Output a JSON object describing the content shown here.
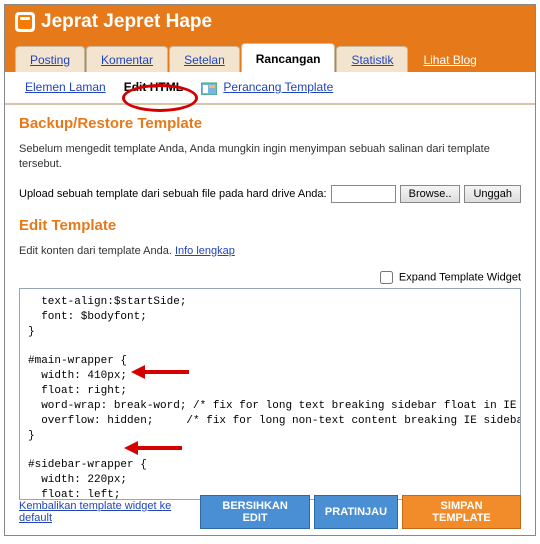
{
  "header": {
    "title": "Jeprat Jepret Hape"
  },
  "tabs": [
    "Posting",
    "Komentar",
    "Setelan",
    "Rancangan",
    "Statistik",
    "Lihat Blog"
  ],
  "active_tab": 3,
  "subtabs": {
    "items": [
      "Elemen Laman",
      "Edit HTML",
      "Perancang Template"
    ],
    "active": 1
  },
  "backup": {
    "heading": "Backup/Restore Template",
    "desc": "Sebelum mengedit template Anda, Anda mungkin ingin menyimpan sebuah salinan dari template tersebut.",
    "upload_label": "Upload sebuah template dari sebuah file pada hard drive Anda:",
    "browse": "Browse..",
    "upload_btn": "Unggah"
  },
  "edit": {
    "heading": "Edit Template",
    "desc_prefix": "Edit konten dari template Anda. ",
    "info_link": "Info lengkap",
    "expand_label": "Expand Template Widget"
  },
  "code": "  text-align:$startSide;\n  font: $bodyfont;\n}\n\n#main-wrapper {\n  width: 410px;\n  float: right;\n  word-wrap: break-word; /* fix for long text breaking sidebar float in IE */\n  overflow: hidden;     /* fix for long non-text content breaking IE sidebar float */\n}\n\n#sidebar-wrapper {\n  width: 220px;\n  float: left;\n  word-wrap: break-word; /* fix for long text breaking sidebar float in IE */\n  overflow: hidden;     /* fix for long non-text content breaking IE sidebar float\n*/\n}\n\n\n/* Headings",
  "footer": {
    "reset_link": "Kembalikan template widget ke default",
    "clear": "BERSIHKAN EDIT",
    "preview": "PRATINJAU",
    "save": "SIMPAN TEMPLATE"
  }
}
